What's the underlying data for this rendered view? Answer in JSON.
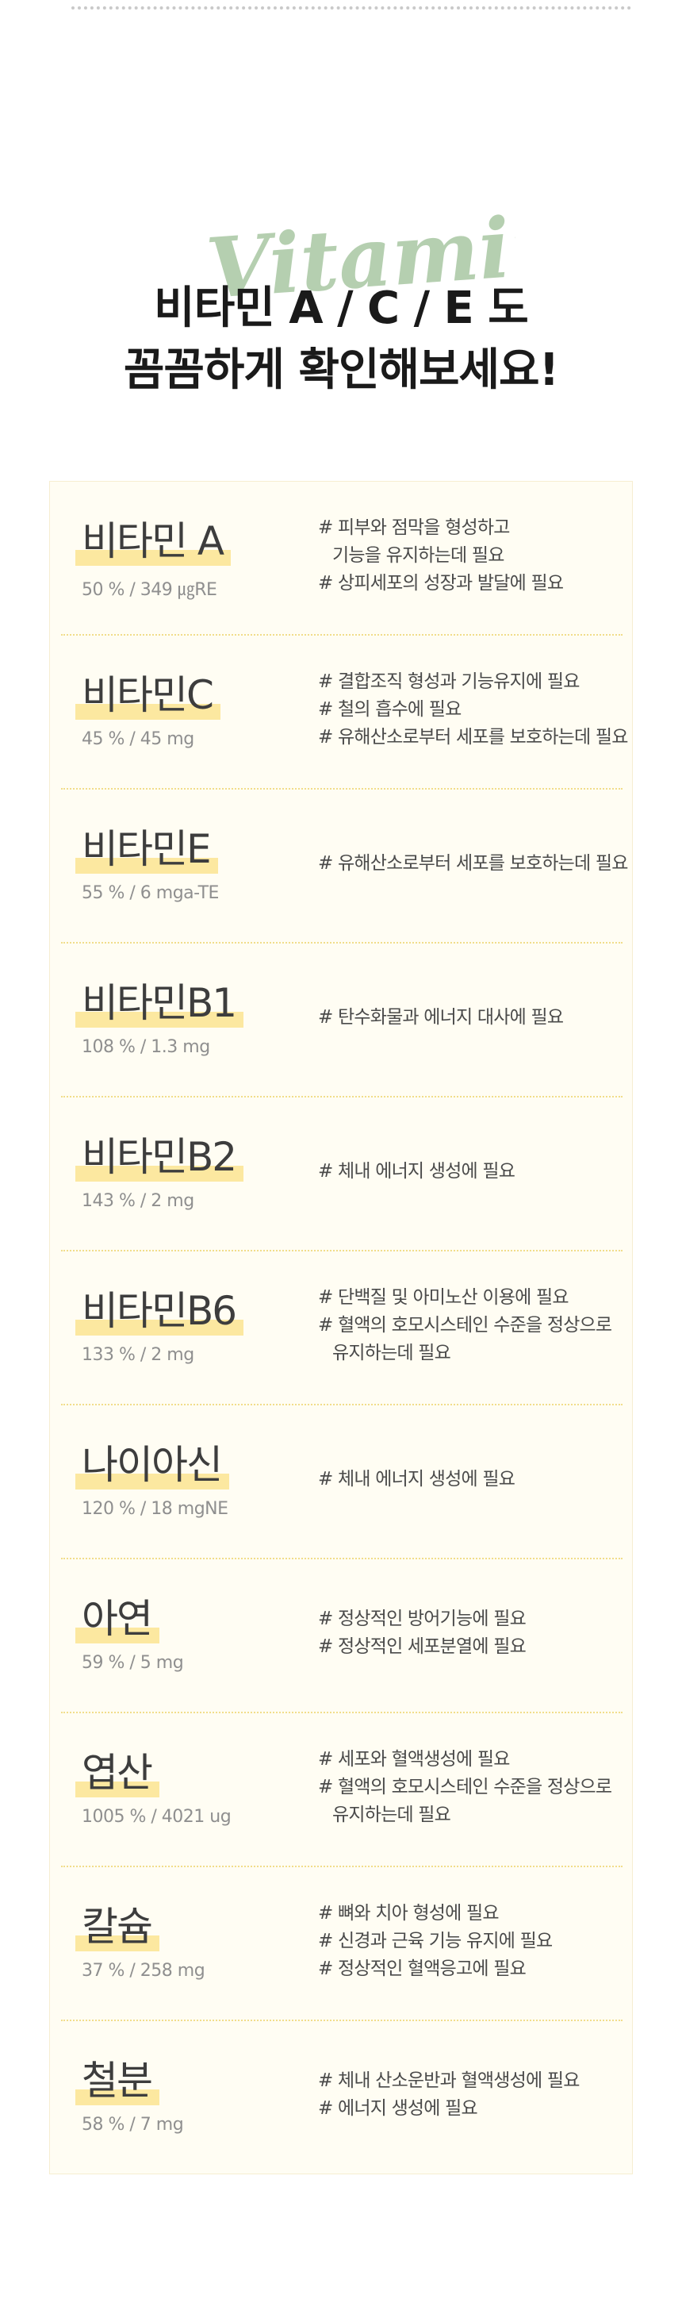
{
  "header": {
    "script_word": "Vitamin",
    "title_line1": "비타민 A / C / E 도",
    "title_line2": "꼼꼼하게 확인해보세요!"
  },
  "nutrients": [
    {
      "name": "비타민 A",
      "amount": "50 % / 349 ㎍RE",
      "desc": [
        "# 피부와 점막을 형성하고",
        "기능을 유지하는데 필요",
        "# 상피세포의 성장과 발달에 필요"
      ]
    },
    {
      "name": "비타민C",
      "amount": "45 % / 45 mg",
      "desc": [
        "# 결합조직 형성과 기능유지에 필요",
        "# 철의 흡수에 필요",
        "# 유해산소로부터 세포를 보호하는데 필요"
      ]
    },
    {
      "name": "비타민E",
      "amount": "55 % / 6 mga-TE",
      "desc": [
        "# 유해산소로부터 세포를 보호하는데 필요"
      ]
    },
    {
      "name": "비타민B1",
      "amount": "108 % / 1.3 mg",
      "desc": [
        "# 탄수화물과 에너지 대사에 필요"
      ]
    },
    {
      "name": "비타민B2",
      "amount": "143 % / 2 mg",
      "desc": [
        "# 체내 에너지 생성에 필요"
      ]
    },
    {
      "name": "비타민B6",
      "amount": "133 % / 2 mg",
      "desc": [
        "# 단백질 및 아미노산 이용에 필요",
        "# 혈액의 호모시스테인 수준을 정상으로",
        "유지하는데 필요"
      ]
    },
    {
      "name": "나이아신",
      "amount": "120 % / 18 mgNE",
      "desc": [
        "# 체내 에너지 생성에 필요"
      ]
    },
    {
      "name": "아연",
      "amount": "59 % / 5 mg",
      "desc": [
        "# 정상적인 방어기능에 필요",
        "# 정상적인 세포분열에 필요"
      ]
    },
    {
      "name": "엽산",
      "amount": "1005 % / 4021 ug",
      "desc": [
        "# 세포와 혈액생성에 필요",
        "# 혈액의 호모시스테인 수준을 정상으로",
        "유지하는데 필요"
      ]
    },
    {
      "name": "칼슘",
      "amount": "37 % / 258 mg",
      "desc": [
        "# 뼈와 치아 형성에 필요",
        "# 신경과 근육 기능 유지에 필요",
        "# 정상적인 혈액응고에 필요"
      ]
    },
    {
      "name": "철분",
      "amount": "58 % / 7 mg",
      "desc": [
        "# 체내 산소운반과 혈액생성에 필요",
        "# 에너지 생성에 필요"
      ]
    }
  ],
  "colors": {
    "highlight": "#fce8a0",
    "card_bg": "#fffdf3",
    "script_green": "#9fc19a"
  }
}
